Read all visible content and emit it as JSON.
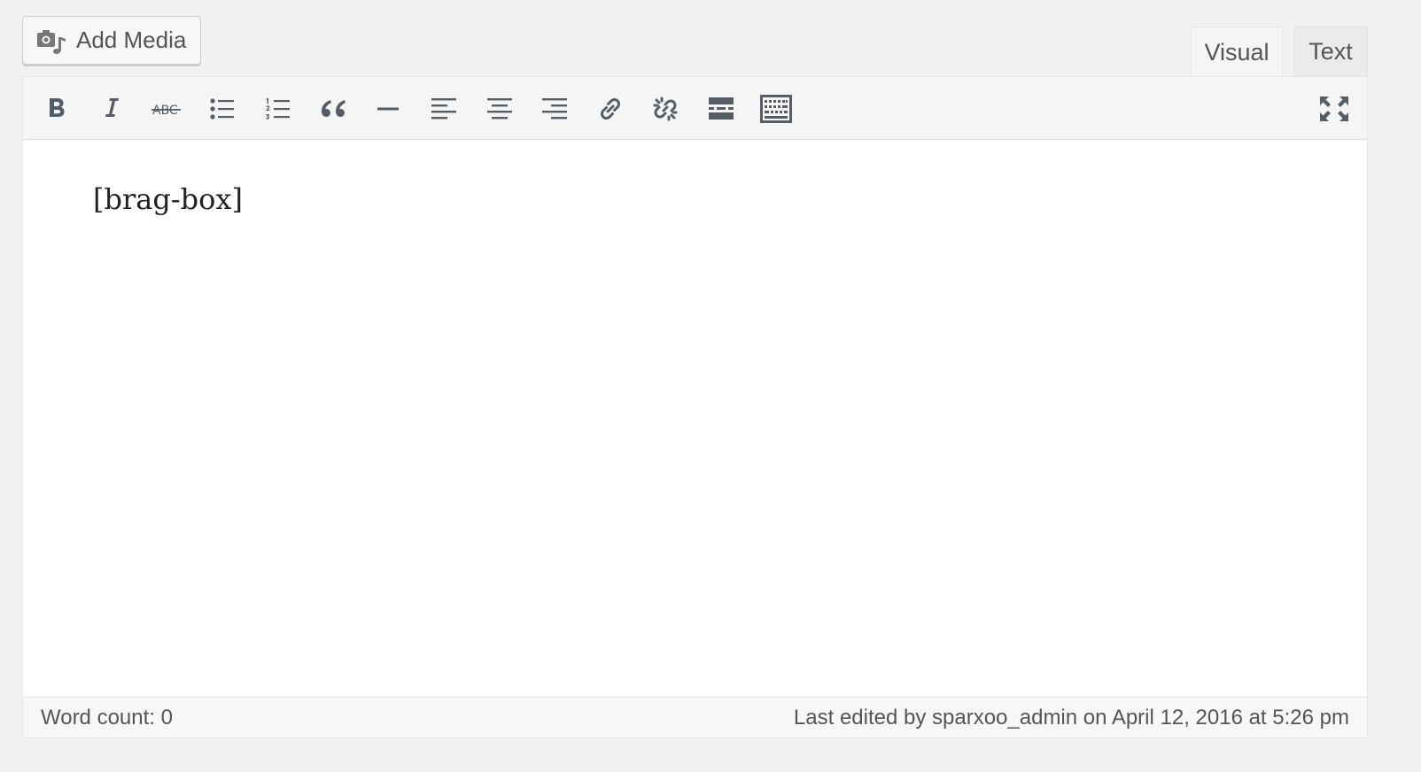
{
  "add_media": {
    "label": "Add Media",
    "icon": "camera-music-icon"
  },
  "tabs": [
    {
      "label": "Visual",
      "active": true
    },
    {
      "label": "Text",
      "active": false
    }
  ],
  "toolbar": {
    "buttons": [
      {
        "name": "bold",
        "icon": "bold-icon"
      },
      {
        "name": "italic",
        "icon": "italic-icon"
      },
      {
        "name": "strikethrough",
        "icon": "strikethrough-icon",
        "glyph_text": "ABC"
      },
      {
        "name": "bulleted-list",
        "icon": "bulleted-list-icon"
      },
      {
        "name": "numbered-list",
        "icon": "numbered-list-icon"
      },
      {
        "name": "blockquote",
        "icon": "blockquote-icon"
      },
      {
        "name": "horizontal-line",
        "icon": "horizontal-line-icon"
      },
      {
        "name": "align-left",
        "icon": "align-left-icon"
      },
      {
        "name": "align-center",
        "icon": "align-center-icon"
      },
      {
        "name": "align-right",
        "icon": "align-right-icon"
      },
      {
        "name": "insert-link",
        "icon": "link-icon"
      },
      {
        "name": "remove-link",
        "icon": "unlink-icon"
      },
      {
        "name": "read-more",
        "icon": "read-more-icon"
      },
      {
        "name": "toolbar-toggle",
        "icon": "keyboard-icon"
      },
      {
        "name": "fullscreen",
        "icon": "fullscreen-icon"
      }
    ]
  },
  "content": {
    "text": "[brag-box]"
  },
  "status": {
    "word_count": "Word count: 0",
    "last_edited": "Last edited by sparxoo_admin on April 12, 2016 at 5:26 pm"
  },
  "colors": {
    "icon": "#555d66",
    "background": "#f1f1f1",
    "toolbar": "#f5f5f5"
  }
}
